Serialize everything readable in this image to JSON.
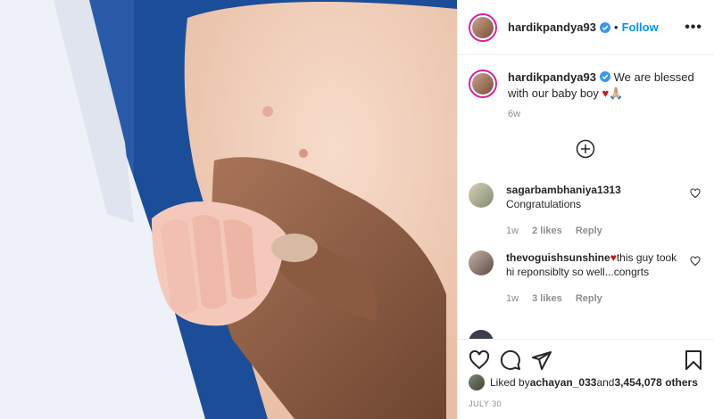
{
  "post": {
    "username": "hardikpandya93",
    "follow_label": "Follow",
    "more_label": "•••",
    "separator": "•"
  },
  "caption": {
    "username": "hardikpandya93",
    "text": "We are blessed with our baby boy ",
    "emoji": "♥🙏🏼",
    "time_ago": "6w"
  },
  "comments": [
    {
      "username": "sagarbambhaniya1313",
      "text": "Congratulations",
      "time": "1w",
      "likes": "2 likes",
      "reply": "Reply"
    },
    {
      "username": "thevoguishsunshine",
      "text": "this guy took hi reponsiblty so well...congrts",
      "emoji": "♥",
      "time": "1w",
      "likes": "3 likes",
      "reply": "Reply"
    }
  ],
  "likes_line": {
    "prefix": "Liked by ",
    "user": "achayan_033",
    "middle": " and ",
    "count": "3,454,078 others"
  },
  "date": "JULY 30",
  "icons": {
    "verified": "verified-badge-icon",
    "heart": "heart-icon",
    "comment": "comment-icon",
    "share": "share-icon",
    "save": "bookmark-icon",
    "load_more": "plus-circle-icon",
    "more": "more-icon"
  },
  "colors": {
    "accent": "#0095f6",
    "heart": "#c4161c",
    "muted": "#8e8e8e"
  }
}
